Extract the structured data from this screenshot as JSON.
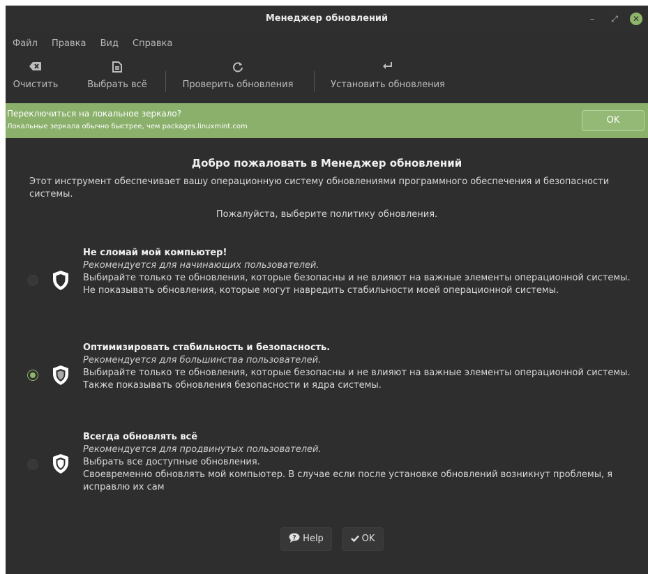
{
  "window": {
    "title": "Менеджер обновлений",
    "min_glyph": "–",
    "max_glyph": "⤢",
    "close_glyph": "✕"
  },
  "menu": [
    "Файл",
    "Правка",
    "Вид",
    "Справка"
  ],
  "toolbar": {
    "clear": "Очистить",
    "select_all": "Выбрать всё",
    "check": "Проверить обновления",
    "install": "Установить обновления"
  },
  "infobar": {
    "title": "Переключиться на локальное зеркало?",
    "subtitle": "Локальные зеркала обычно быстрее, чем packages.linuxmint.com",
    "ok": "OK"
  },
  "welcome": {
    "title": "Добро пожаловать в Менеджер обновлений",
    "description": "Этот инструмент обеспечивает вашу операционную систему обновлениями программного обеспечения и безопасности системы.",
    "prompt": "Пожалуйста, выберите политику обновления."
  },
  "policies": [
    {
      "title": "Не сломай мой компьютер!",
      "recommended": "Рекомендуется для начинающих пользователей.",
      "line1": "Выбирайте только те обновления, которые безопасны и не влияют на важные элементы операционной системы.",
      "line2": "Не показывать обновления, которые могут навредить стабильности моей операционной системы.",
      "selected": false
    },
    {
      "title": "Оптимизировать стабильность и безопасность.",
      "recommended": "Рекомендуется для большинства пользователей.",
      "line1": "Выбирайте только те обновления, которые безопасны и не влияют на важные элементы операционной системы.",
      "line2": "Также показывать обновления безопасности и ядра системы.",
      "selected": true
    },
    {
      "title": "Всегда обновлять всё",
      "recommended": "Рекомендуется для продвинутых пользователей.",
      "line1": "Выбрать все доступные обновления.",
      "line2": "Своевременно обновлять мой компьютер. В случае если после установке обновлений возникнут проблемы, я исправлю их сам",
      "selected": false
    }
  ],
  "buttons": {
    "help": "Help",
    "ok": "OK"
  },
  "colors": {
    "accent": "#8fb56a",
    "infobar": "#8ab06b",
    "background": "#2e2e2e"
  }
}
